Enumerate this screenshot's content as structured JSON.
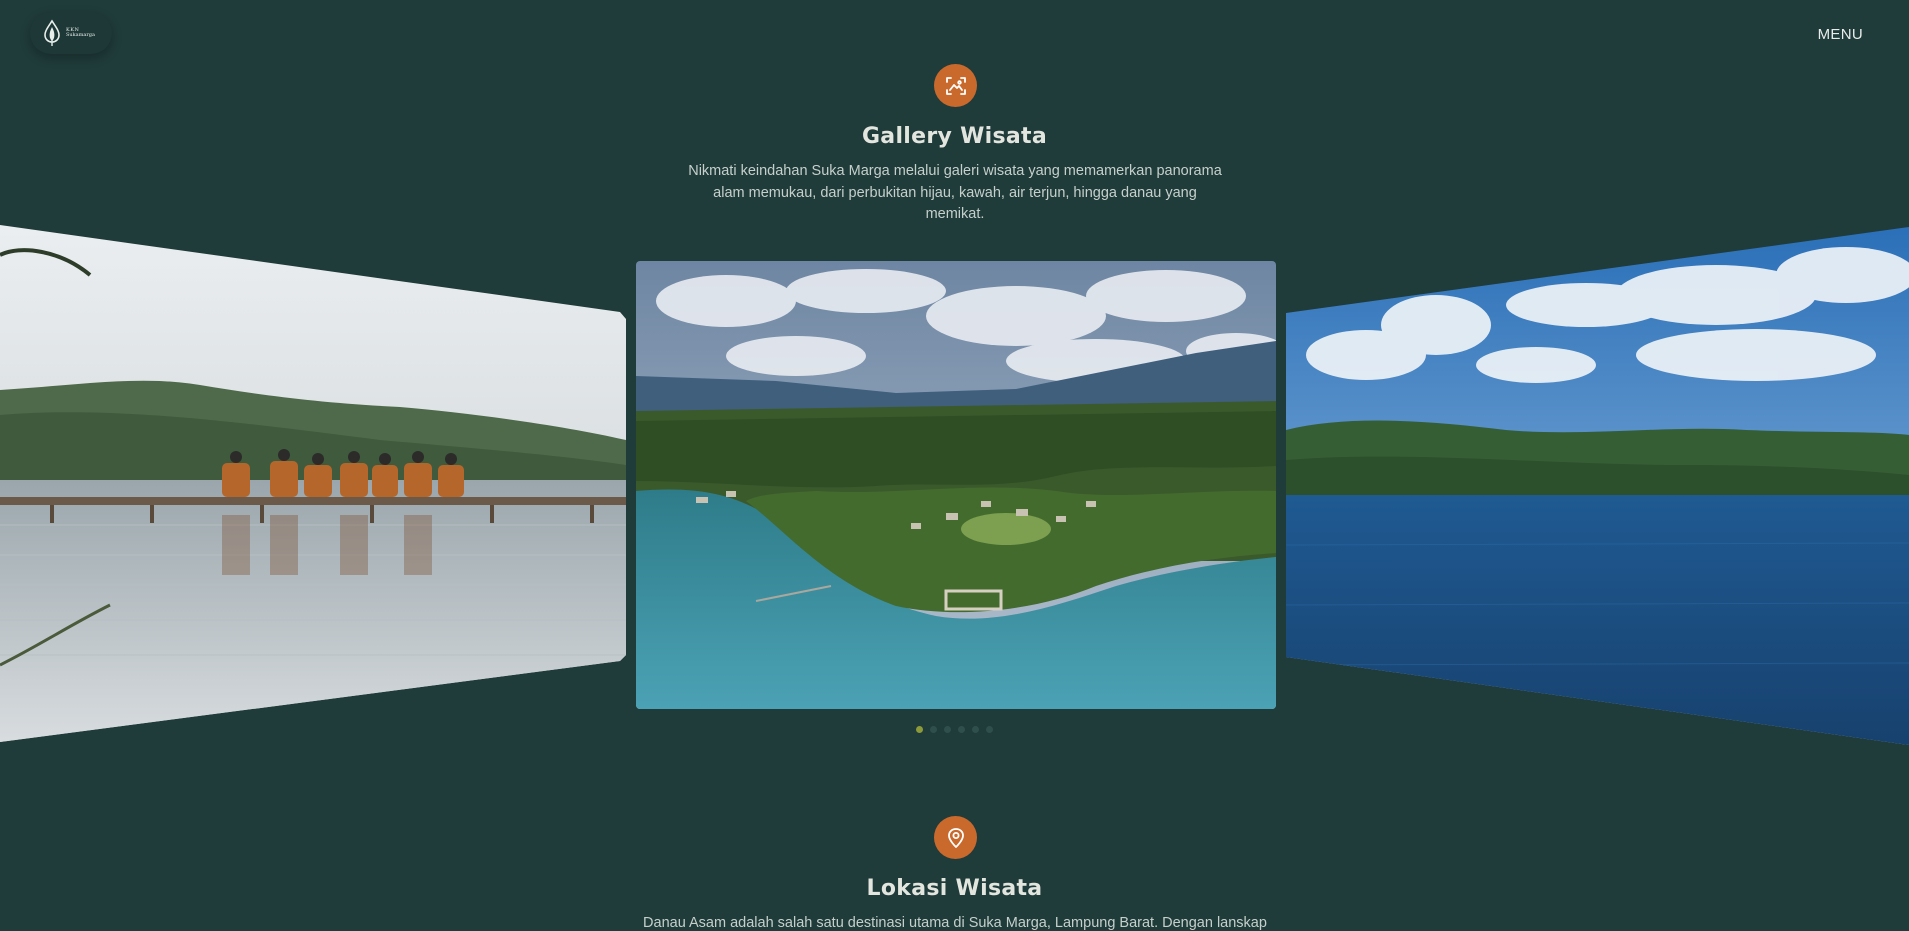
{
  "header": {
    "logo_line1": "KKN",
    "logo_line2": "Sukamarga",
    "menu_label": "MENU"
  },
  "gallery": {
    "icon": "scan-image-icon",
    "title": "Gallery Wisata",
    "description": "Nikmati keindahan Suka Marga melalui galeri wisata yang memamerkan panorama alam memukau, dari perbukitan hijau, kawah, air terjun, hingga danau yang memikat.",
    "slides": [
      {
        "name": "lake-pier-group-photo"
      },
      {
        "name": "aerial-village-lake-photo"
      },
      {
        "name": "blue-lake-hills-photo"
      }
    ],
    "dots_count": 6,
    "active_dot": 0
  },
  "location": {
    "icon": "map-pin-icon",
    "title": "Lokasi Wisata",
    "description": "Danau Asam adalah salah satu destinasi utama di Suka Marga, Lampung Barat. Dengan lanskap"
  },
  "colors": {
    "background": "#1f3b3a",
    "accent": "#c9692c",
    "dot_active": "#8c9a3a",
    "dot_inactive": "#2f4f4d"
  }
}
